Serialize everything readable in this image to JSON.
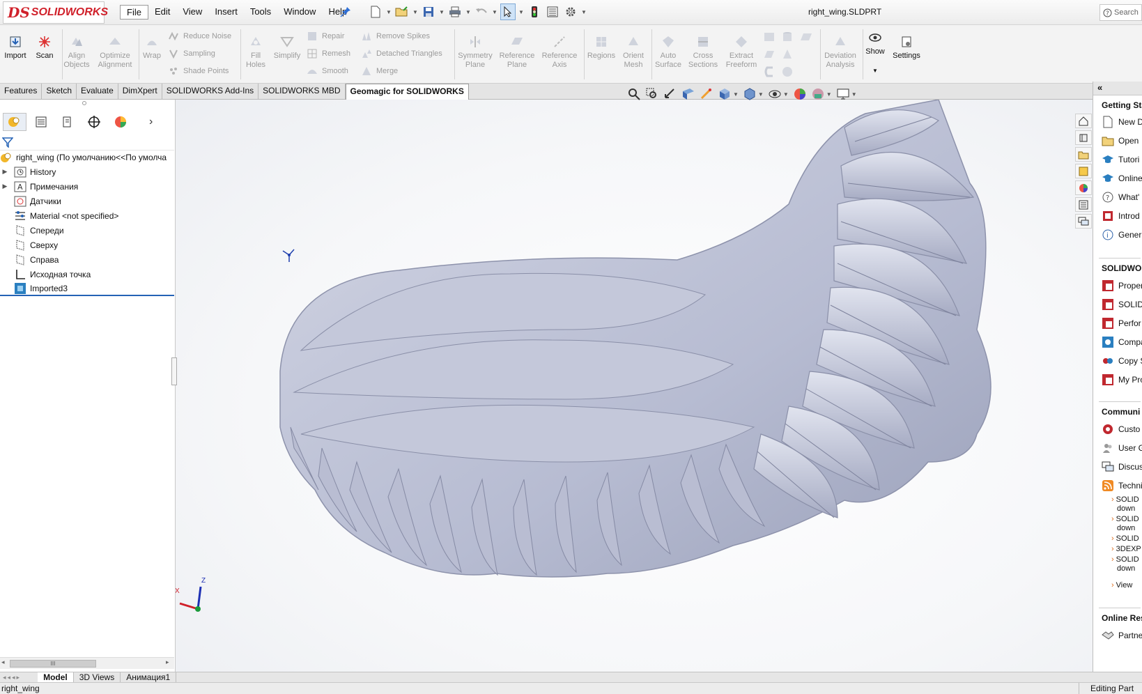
{
  "app": {
    "logo_prefix": "DS",
    "logo_text": "SOLIDWORKS",
    "document_title": "right_wing.SLDPRT",
    "search_placeholder": "Search"
  },
  "menu": [
    "File",
    "Edit",
    "View",
    "Insert",
    "Tools",
    "Window",
    "Help"
  ],
  "ribbon": {
    "import": "Import",
    "scan": "Scan",
    "align_objects": [
      "Align",
      "Objects"
    ],
    "optimize_alignment": [
      "Optimize",
      "Alignment"
    ],
    "wrap": "Wrap",
    "reduce_noise": "Reduce Noise",
    "sampling": "Sampling",
    "shade_points": "Shade Points",
    "fill_holes": [
      "Fill",
      "Holes"
    ],
    "simplify": "Simplify",
    "repair": "Repair",
    "remesh": "Remesh",
    "smooth": "Smooth",
    "remove_spikes": "Remove Spikes",
    "detached_triangles": "Detached Triangles",
    "merge": "Merge",
    "symmetry_plane": [
      "Symmetry",
      "Plane"
    ],
    "reference_plane": [
      "Reference",
      "Plane"
    ],
    "reference_axis": [
      "Reference",
      "Axis"
    ],
    "regions": "Regions",
    "orient_mesh": [
      "Orient",
      "Mesh"
    ],
    "auto_surface": [
      "Auto",
      "Surface"
    ],
    "cross_sections": [
      "Cross",
      "Sections"
    ],
    "extract_freeform": [
      "Extract",
      "Freeform"
    ],
    "deviation_analysis": [
      "Deviation",
      "Analysis"
    ],
    "show": "Show",
    "settings": "Settings"
  },
  "tabs": [
    "Features",
    "Sketch",
    "Evaluate",
    "DimXpert",
    "SOLIDWORKS Add-Ins",
    "SOLIDWORKS MBD",
    "Geomagic for SOLIDWORKS"
  ],
  "active_tab": "Geomagic for SOLIDWORKS",
  "tree": {
    "root": "right_wing  (По умолчанию<<По умолча",
    "items": [
      {
        "label": "History",
        "icon": "history-icon",
        "expandable": true
      },
      {
        "label": "Примечания",
        "icon": "annotations-icon",
        "expandable": true
      },
      {
        "label": "Датчики",
        "icon": "sensors-icon",
        "expandable": false
      },
      {
        "label": "Material <not specified>",
        "icon": "material-icon",
        "expandable": false
      },
      {
        "label": "Спереди",
        "icon": "plane-icon",
        "expandable": false
      },
      {
        "label": "Сверху",
        "icon": "plane-icon",
        "expandable": false
      },
      {
        "label": "Справа",
        "icon": "plane-icon",
        "expandable": false
      },
      {
        "label": "Исходная точка",
        "icon": "origin-icon",
        "expandable": false
      },
      {
        "label": "Imported3",
        "icon": "imported-body-icon",
        "expandable": false
      }
    ]
  },
  "scrollbar_thumb": "III",
  "bottom_tabs": [
    "Model",
    "3D Views",
    "Анимация1"
  ],
  "active_bottom_tab": "Model",
  "status": {
    "left": "right_wing",
    "right": "Editing Part"
  },
  "triad": {
    "x": "X",
    "z": "Z"
  },
  "task_pane": {
    "sections": [
      {
        "title": "Getting Sta",
        "items": [
          "New D",
          "Open",
          "Tutori",
          "Online",
          "What'",
          "Introd",
          "Gener"
        ]
      },
      {
        "title": "SOLIDWOR",
        "items": [
          "Proper",
          "SOLID",
          "Perfor",
          "Compa",
          "Copy S",
          "My Pro"
        ]
      },
      {
        "title": "Communi",
        "items": [
          "Custo",
          "User G",
          "Discus",
          "Technic"
        ]
      }
    ],
    "news": [
      [
        "SOLID",
        "down"
      ],
      [
        "SOLID",
        "down"
      ],
      [
        "SOLID"
      ],
      [
        "3DEXP"
      ],
      [
        "SOLID",
        "down"
      ]
    ],
    "view_link": "View",
    "online_resources": "Online Res",
    "partner": "Partne"
  },
  "colors": {
    "accent_red": "#d0202a",
    "mesh": "#b7bcd2",
    "selection_blue": "#cfe3f7"
  }
}
